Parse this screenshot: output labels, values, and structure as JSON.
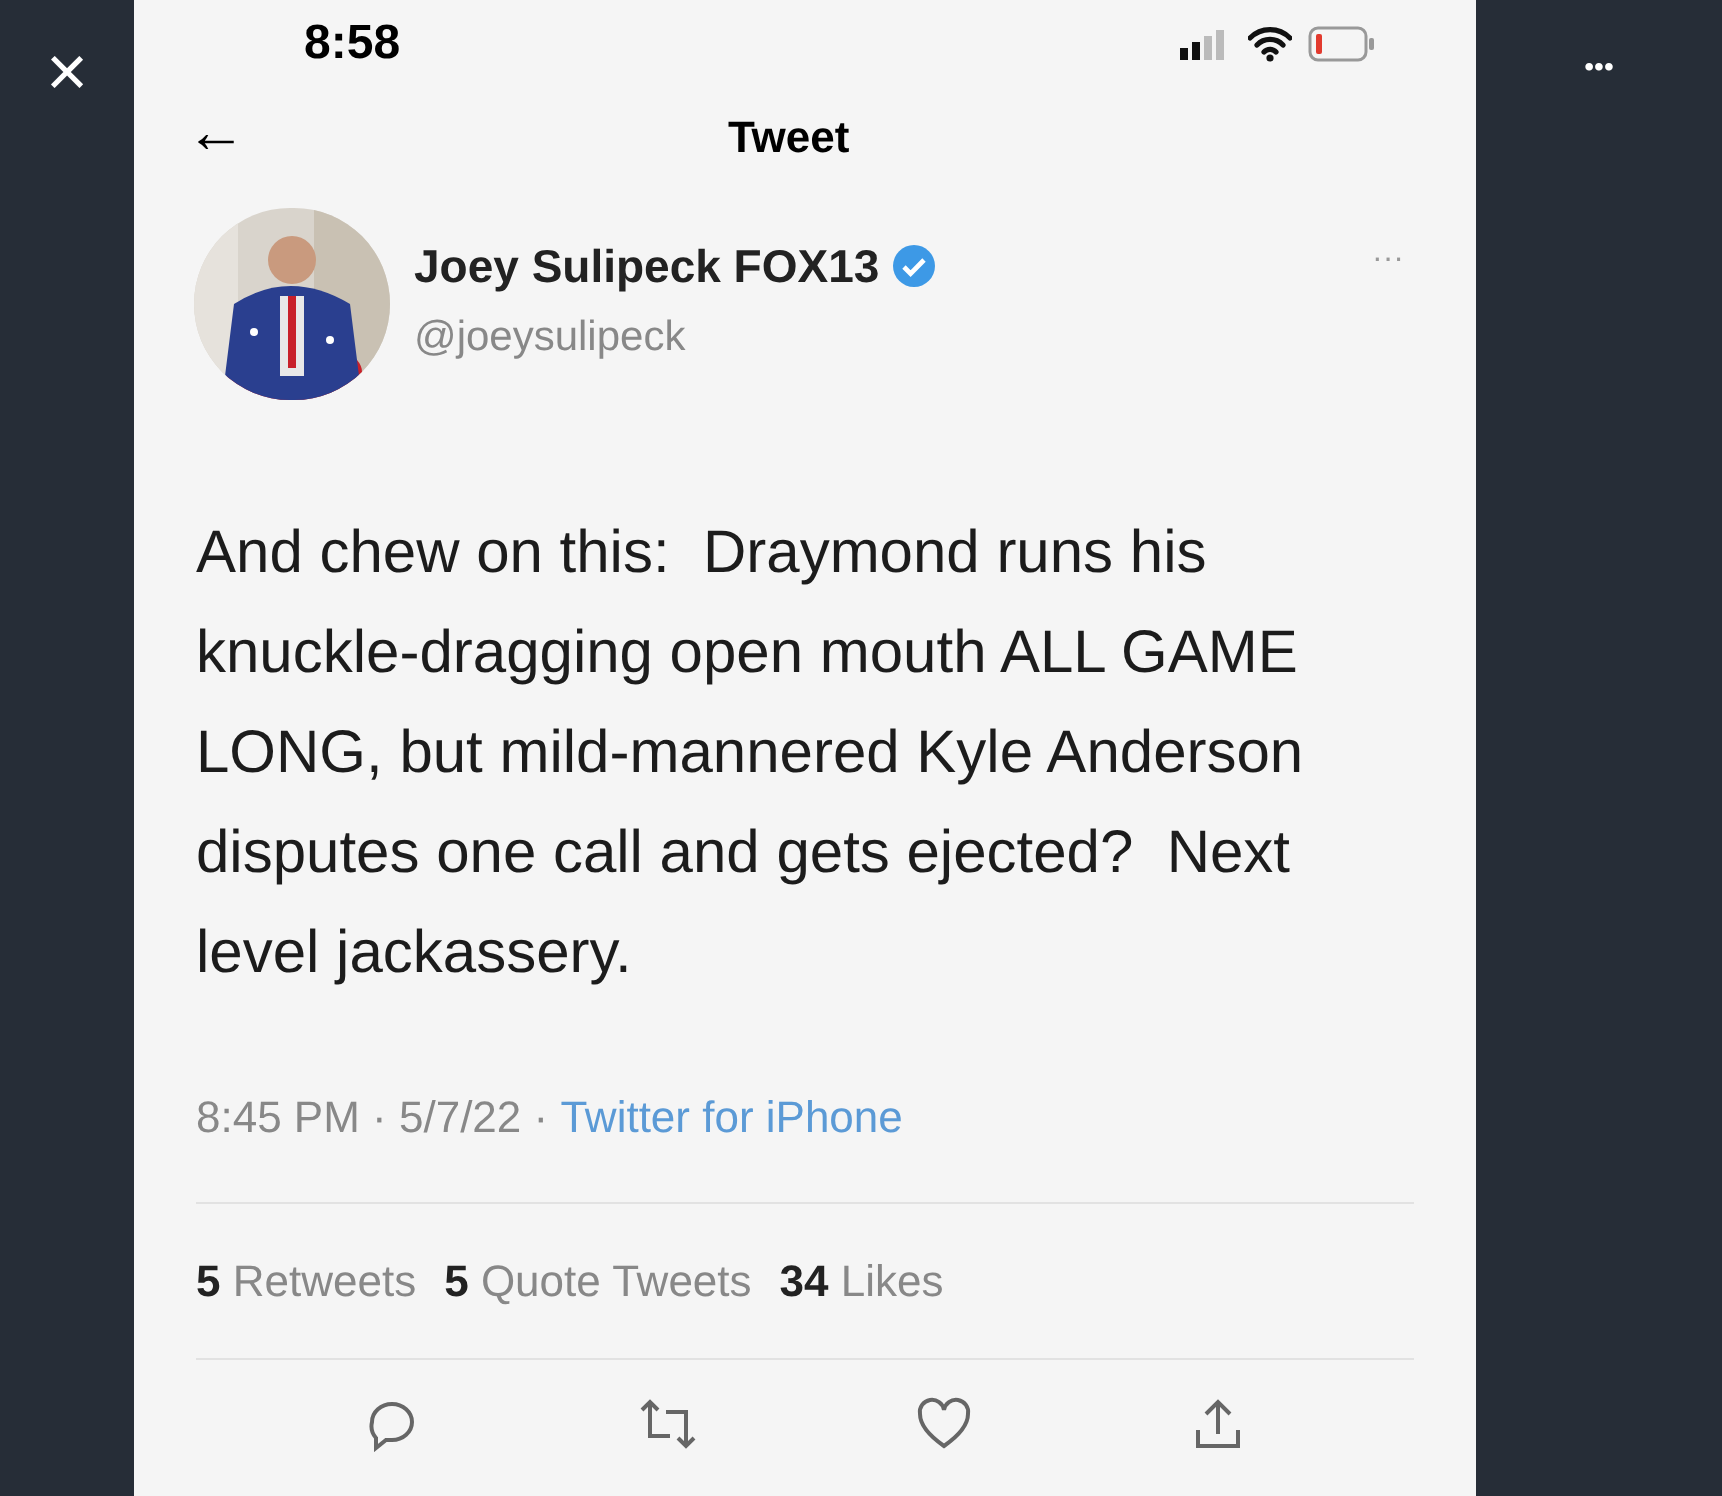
{
  "viewer": {
    "close": "×",
    "more": "•••"
  },
  "status_bar": {
    "time": "8:58"
  },
  "header": {
    "back": "←",
    "title": "Tweet"
  },
  "author": {
    "name": "Joey Sulipeck FOX13",
    "verified": true,
    "handle": "@joeysulipeck",
    "menu": "···"
  },
  "tweet": {
    "text": "And chew on this:  Draymond runs his knuckle-dragging open mouth ALL GAME LONG, but mild-mannered Kyle Anderson disputes one call and gets ejected?  Next level jackassery.",
    "time": "8:45 PM · 5/7/22 · ",
    "source": "Twitter for iPhone"
  },
  "stats": [
    {
      "count": "5",
      "label": "Retweets"
    },
    {
      "count": "5",
      "label": "Quote Tweets"
    },
    {
      "count": "34",
      "label": "Likes"
    }
  ]
}
